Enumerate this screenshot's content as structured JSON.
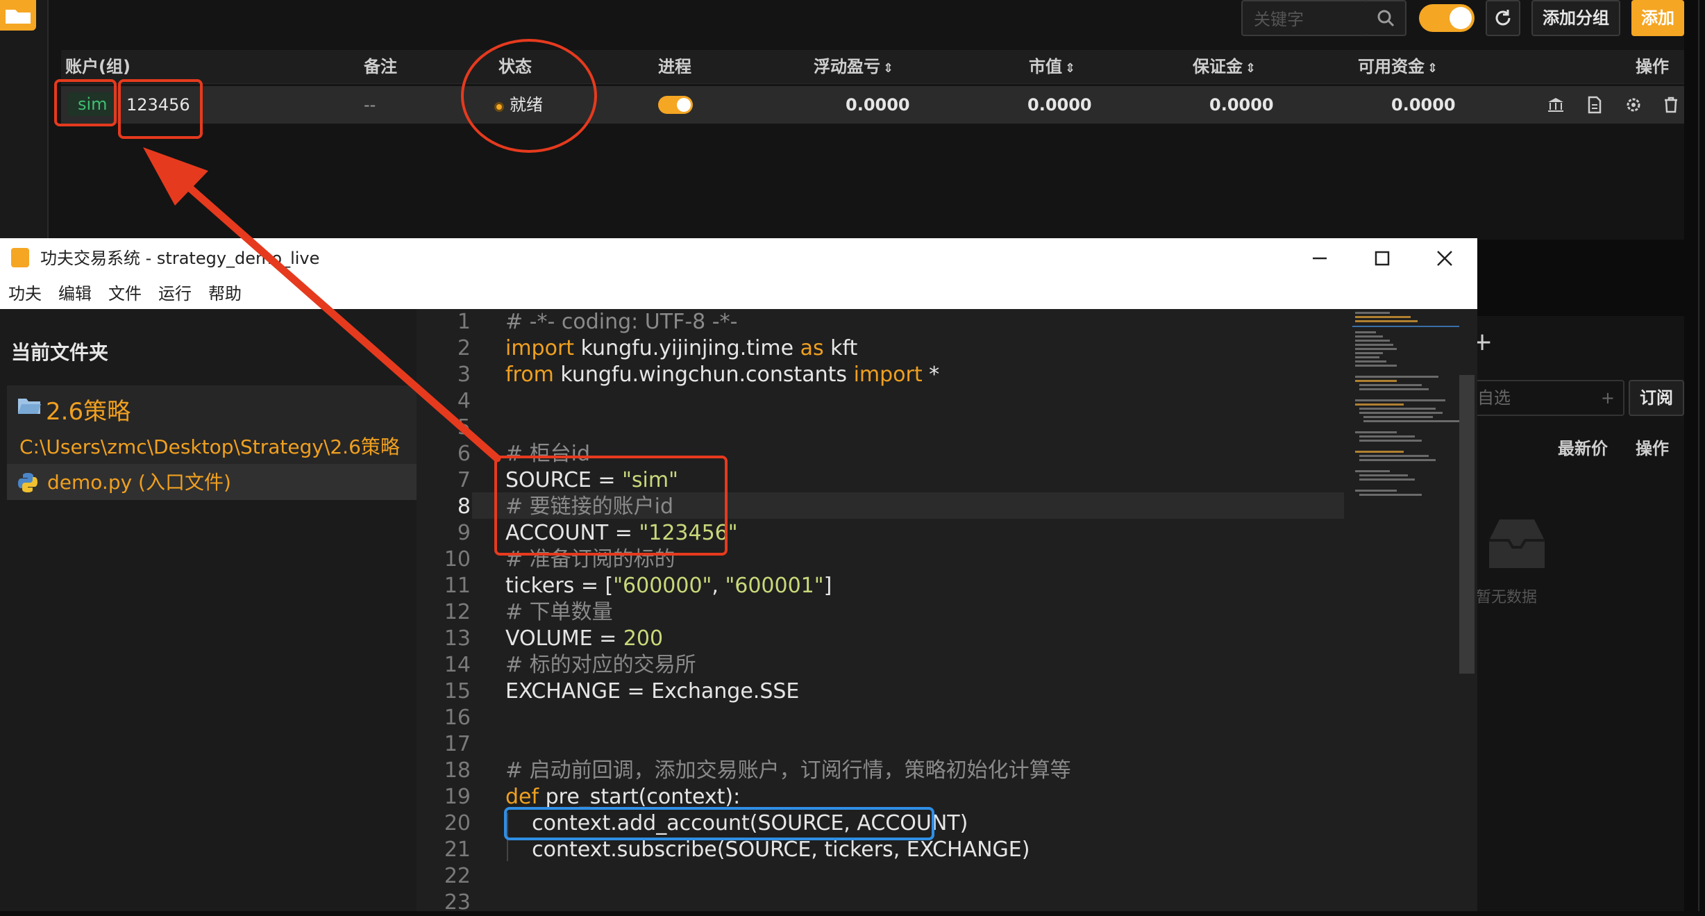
{
  "top_app": {
    "search_placeholder": "关键字",
    "add_group_label": "添加分组",
    "add_label": "添加",
    "table": {
      "headers": {
        "account": "账户(组)",
        "note": "备注",
        "status": "状态",
        "process": "进程",
        "float_pnl": "浮动盈亏",
        "market_value": "市值",
        "margin": "保证金",
        "available": "可用资金",
        "actions": "操作"
      },
      "row": {
        "source": "sim",
        "account_id": "123456",
        "note": "--",
        "status": "就绪",
        "float_pnl": "0.0000",
        "market_value": "0.0000",
        "margin": "0.0000",
        "available": "0.0000"
      }
    }
  },
  "right_panel": {
    "input_placeholder": "自选",
    "subscribe_label": "订阅",
    "col_latest": "最新价",
    "col_actions": "操作",
    "empty_text": "暂无数据"
  },
  "window": {
    "title": "功夫交易系统 - strategy_demo_live",
    "menu": [
      "功夫",
      "编辑",
      "文件",
      "运行",
      "帮助"
    ]
  },
  "sidebar": {
    "title": "当前文件夹",
    "folder_name": "2.6策略",
    "folder_path": "C:\\Users\\zmc\\Desktop\\Strategy\\2.6策略",
    "file_name": "demo.py (入口文件)"
  },
  "code": {
    "active_line": 8,
    "lines": [
      {
        "n": "1",
        "parts": [
          {
            "t": "# -*- coding: UTF-8 -*-",
            "c": "cm"
          }
        ]
      },
      {
        "n": "2",
        "parts": [
          {
            "t": "import",
            "c": "kw"
          },
          {
            "t": " kungfu.yijinjing.time ",
            "c": "df"
          },
          {
            "t": "as",
            "c": "kw"
          },
          {
            "t": " kft",
            "c": "df"
          }
        ]
      },
      {
        "n": "3",
        "parts": [
          {
            "t": "from",
            "c": "kw"
          },
          {
            "t": " kungfu.wingchun.constants ",
            "c": "df"
          },
          {
            "t": "import",
            "c": "kw"
          },
          {
            "t": " *",
            "c": "df"
          }
        ]
      },
      {
        "n": "4",
        "parts": []
      },
      {
        "n": "5",
        "parts": []
      },
      {
        "n": "6",
        "parts": [
          {
            "t": "# 柜台id",
            "c": "cm"
          }
        ]
      },
      {
        "n": "7",
        "parts": [
          {
            "t": "SOURCE = ",
            "c": "df"
          },
          {
            "t": "\"sim\"",
            "c": "str"
          }
        ]
      },
      {
        "n": "8",
        "parts": [
          {
            "t": "# 要链接的账户id",
            "c": "cm"
          }
        ]
      },
      {
        "n": "9",
        "parts": [
          {
            "t": "ACCOUNT = ",
            "c": "df"
          },
          {
            "t": "\"123456\"",
            "c": "str"
          }
        ]
      },
      {
        "n": "10",
        "parts": [
          {
            "t": "# 准备订阅的标的",
            "c": "cm"
          }
        ]
      },
      {
        "n": "11",
        "parts": [
          {
            "t": "tickers = [",
            "c": "df"
          },
          {
            "t": "\"600000\"",
            "c": "str"
          },
          {
            "t": ", ",
            "c": "df"
          },
          {
            "t": "\"600001\"",
            "c": "str"
          },
          {
            "t": "]",
            "c": "df"
          }
        ]
      },
      {
        "n": "12",
        "parts": [
          {
            "t": "# 下单数量",
            "c": "cm"
          }
        ]
      },
      {
        "n": "13",
        "parts": [
          {
            "t": "VOLUME = ",
            "c": "df"
          },
          {
            "t": "200",
            "c": "str"
          }
        ]
      },
      {
        "n": "14",
        "parts": [
          {
            "t": "# 标的对应的交易所",
            "c": "cm"
          }
        ]
      },
      {
        "n": "15",
        "parts": [
          {
            "t": "EXCHANGE = Exchange.SSE",
            "c": "df"
          }
        ]
      },
      {
        "n": "16",
        "parts": []
      },
      {
        "n": "17",
        "parts": []
      },
      {
        "n": "18",
        "parts": [
          {
            "t": "# 启动前回调，添加交易账户，订阅行情，策略初始化计算等",
            "c": "cm"
          }
        ]
      },
      {
        "n": "19",
        "parts": [
          {
            "t": "def",
            "c": "kw"
          },
          {
            "t": " pre_start(context):",
            "c": "df"
          }
        ]
      },
      {
        "n": "20",
        "parts": [
          {
            "t": "    context.add_account(SOURCE, ACCOUNT)",
            "c": "df"
          }
        ]
      },
      {
        "n": "21",
        "parts": [
          {
            "t": "    context.subscribe(SOURCE, tickers, EXCHANGE)",
            "c": "df"
          }
        ]
      },
      {
        "n": "22",
        "parts": []
      },
      {
        "n": "23",
        "parts": []
      }
    ]
  },
  "colors": {
    "accent": "#f5a623",
    "annotation_red": "#e63a1e",
    "annotation_blue": "#2f8fe6",
    "ready_green": "#3fbf72"
  }
}
